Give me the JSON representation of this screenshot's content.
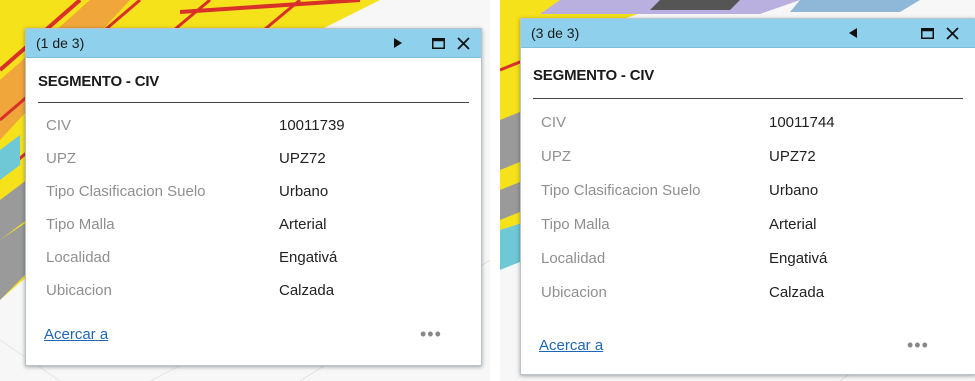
{
  "popups": [
    {
      "counter": "(1 de 3)",
      "nav_icon": "next-arrow-icon",
      "title": "SEGMENTO - CIV",
      "fields": [
        {
          "label": "CIV",
          "value": "10011739"
        },
        {
          "label": "UPZ",
          "value": "UPZ72"
        },
        {
          "label": "Tipo Clasificacion Suelo",
          "value": "Urbano"
        },
        {
          "label": "Tipo Malla",
          "value": "Arterial"
        },
        {
          "label": "Localidad",
          "value": "Engativá"
        },
        {
          "label": "Ubicacion",
          "value": "Calzada"
        }
      ],
      "zoom_link": "Acercar a",
      "more": "•••"
    },
    {
      "counter": "(3 de 3)",
      "nav_icon": "previous-arrow-icon",
      "title": "SEGMENTO - CIV",
      "fields": [
        {
          "label": "CIV",
          "value": "10011744"
        },
        {
          "label": "UPZ",
          "value": "UPZ72"
        },
        {
          "label": "Tipo Clasificacion Suelo",
          "value": "Urbano"
        },
        {
          "label": "Tipo Malla",
          "value": "Arterial"
        },
        {
          "label": "Localidad",
          "value": "Engativá"
        },
        {
          "label": "Ubicacion",
          "value": "Calzada"
        }
      ],
      "zoom_link": "Acercar a",
      "more": "•••"
    }
  ],
  "colors": {
    "titlebar": "#8fd1ec",
    "link": "#1f66b6",
    "label": "#8f8f8f",
    "map_yellow": "#f5e21b",
    "map_red": "#d9302a",
    "map_purple": "#b9b0e0",
    "map_gray": "#9a9a9a"
  }
}
